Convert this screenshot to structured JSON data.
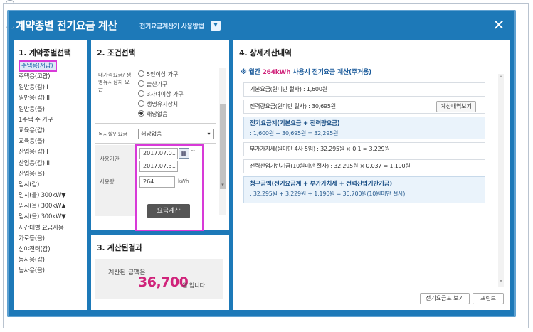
{
  "window": {
    "title": "계약종별 전기요금 계산",
    "help_link": "전기요금계산기 사용방법",
    "close_label": "✕"
  },
  "contract": {
    "heading": "1. 계약종별선택",
    "items": [
      "주택용(저압)",
      "주택용(고압)",
      "일반용(갑) I",
      "일반용(갑) II",
      "일반용(을)",
      "1주택 수 가구",
      "교육용(갑)",
      "교육용(을)",
      "산업용(갑) I",
      "산업용(갑) II",
      "산업용(을)",
      "임시(갑)",
      "임시(을) 300kW▼",
      "임시(을) 300kW▲",
      "임시(을) 300kW▼",
      "시간대별 요금사용",
      "가로등(을)",
      "심야전력(갑)",
      "농사용(갑)",
      "농사용(을)"
    ],
    "selected_index": 0
  },
  "conditions": {
    "heading": "2. 조건선택",
    "discount_label": "대가족요금/ 생명유지장치 요금",
    "options": [
      "5인이상 가구",
      "출산가구",
      "3자녀이상 가구",
      "생명유지장치",
      "해당없음"
    ],
    "selected_option": "해당없음",
    "welfare_label": "복지할인요금",
    "welfare_value": "해당없음",
    "period_label": "사용기간",
    "date_from": "2017.07.01",
    "date_to": "2017.07.31",
    "tilde": "~",
    "usage_label": "사용량",
    "usage_value": "264",
    "usage_unit": "kWh",
    "calc_button": "요금계산"
  },
  "result": {
    "heading": "3. 계산된결과",
    "label": "계산된 금액은",
    "amount": "36,700",
    "suffix": "원 입니다."
  },
  "detail": {
    "heading": "4. 상세계산내역",
    "summary_prefix": "※ 월간 ",
    "summary_kwh": "264kWh",
    "summary_rest": " 사용시 전기요금 계산(주거용)",
    "rows": {
      "basic": "기본요금(원미만 절사) : 1,600원",
      "energy": "전력량요금(원미만 절사) : 30,695원",
      "energy_btn": "계산내역보기",
      "total_title": "전기요금계(기본요금 + 전력량요금)",
      "total_value": ": 1,600원 + 30,695원 = 32,295원",
      "vat": "부가가치세(원미만 4사 5입) : 32,295원 × 0.1 = 3,229원",
      "fund": "전력산업기반기금(10원미만 절사) : 32,295원 × 0.037 = 1,190원",
      "bill_title": "청구금액(전기요금계 + 부가가치세 + 전력산업기반기금)",
      "bill_value": ": 32,295원 + 3,229원 + 1,190원 = 36,700원(10원미만 절사)"
    },
    "btn_table": "전기요금표 보기",
    "btn_print": "프린트"
  },
  "colors": {
    "window": "#1d79b8",
    "accent_pink": "#d0247b",
    "highlight": "#d83ad8"
  }
}
